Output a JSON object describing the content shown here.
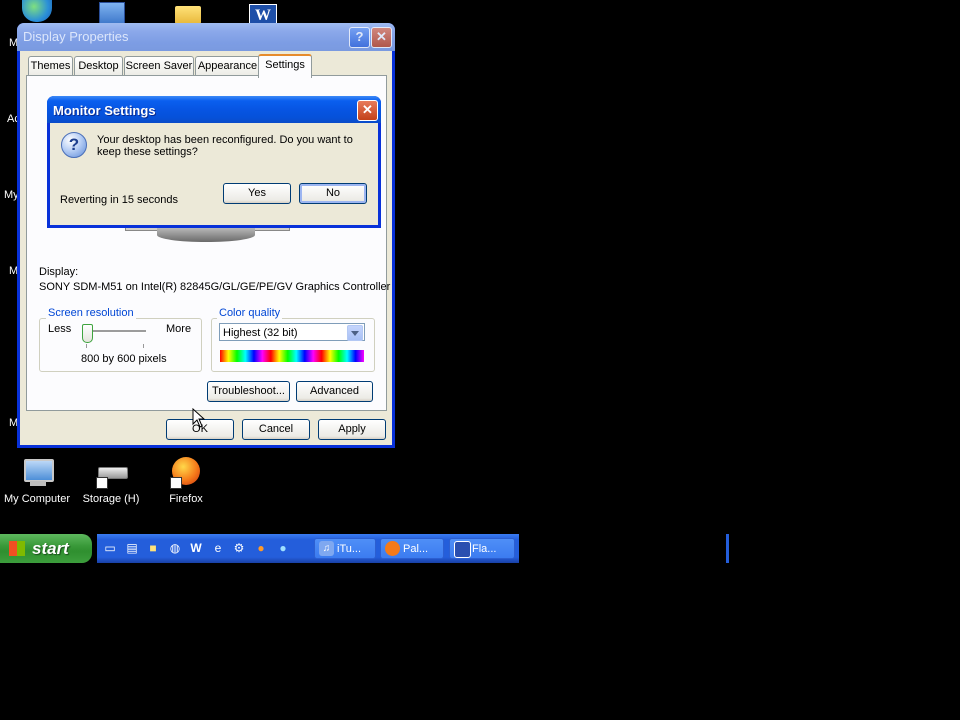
{
  "desktop": {
    "top_icons": [
      {
        "name": "globe",
        "label": ""
      },
      {
        "name": "notepad",
        "label": ""
      },
      {
        "name": "folder",
        "label": ""
      },
      {
        "name": "word",
        "label": "W"
      }
    ],
    "side_labels": [
      "M",
      "Ac",
      "My",
      "M",
      "M"
    ],
    "bottom_icons": [
      {
        "name": "my-computer",
        "label": "My Computer"
      },
      {
        "name": "storage",
        "label": "Storage (H)"
      },
      {
        "name": "firefox",
        "label": "Firefox"
      }
    ]
  },
  "display_properties": {
    "title": "Display Properties",
    "help_glyph": "?",
    "close_glyph": "✕",
    "tabs": [
      "Themes",
      "Desktop",
      "Screen Saver",
      "Appearance",
      "Settings"
    ],
    "active_tab": "Settings",
    "display_label": "Display:",
    "display_value": "SONY SDM-M51 on Intel(R) 82845G/GL/GE/PE/GV Graphics Controller",
    "screen_resolution": {
      "legend": "Screen resolution",
      "less": "Less",
      "more": "More",
      "value": "800 by 600 pixels",
      "slider_fraction": 0.0
    },
    "color_quality": {
      "legend": "Color quality",
      "selected": "Highest (32 bit)"
    },
    "buttons": {
      "troubleshoot": "Troubleshoot...",
      "advanced": "Advanced",
      "ok": "OK",
      "cancel": "Cancel",
      "apply": "Apply"
    }
  },
  "monitor_settings": {
    "title": "Monitor Settings",
    "close_glyph": "✕",
    "icon_glyph": "?",
    "message": "Your desktop has been reconfigured.  Do you want to keep these settings?",
    "countdown": "Reverting in 15 seconds",
    "yes": "Yes",
    "no": "No"
  },
  "taskbar": {
    "start_label": "start",
    "tasks": [
      {
        "label": "iTu...",
        "icon": "itunes-icon"
      },
      {
        "label": "Pal...",
        "icon": "firefox-icon"
      },
      {
        "label": "Fla...",
        "icon": "flash-icon"
      }
    ]
  },
  "colors": {
    "xp_blue": "#0a5fef",
    "dialog_face": "#ece9d8",
    "link_blue": "#0046d5"
  }
}
